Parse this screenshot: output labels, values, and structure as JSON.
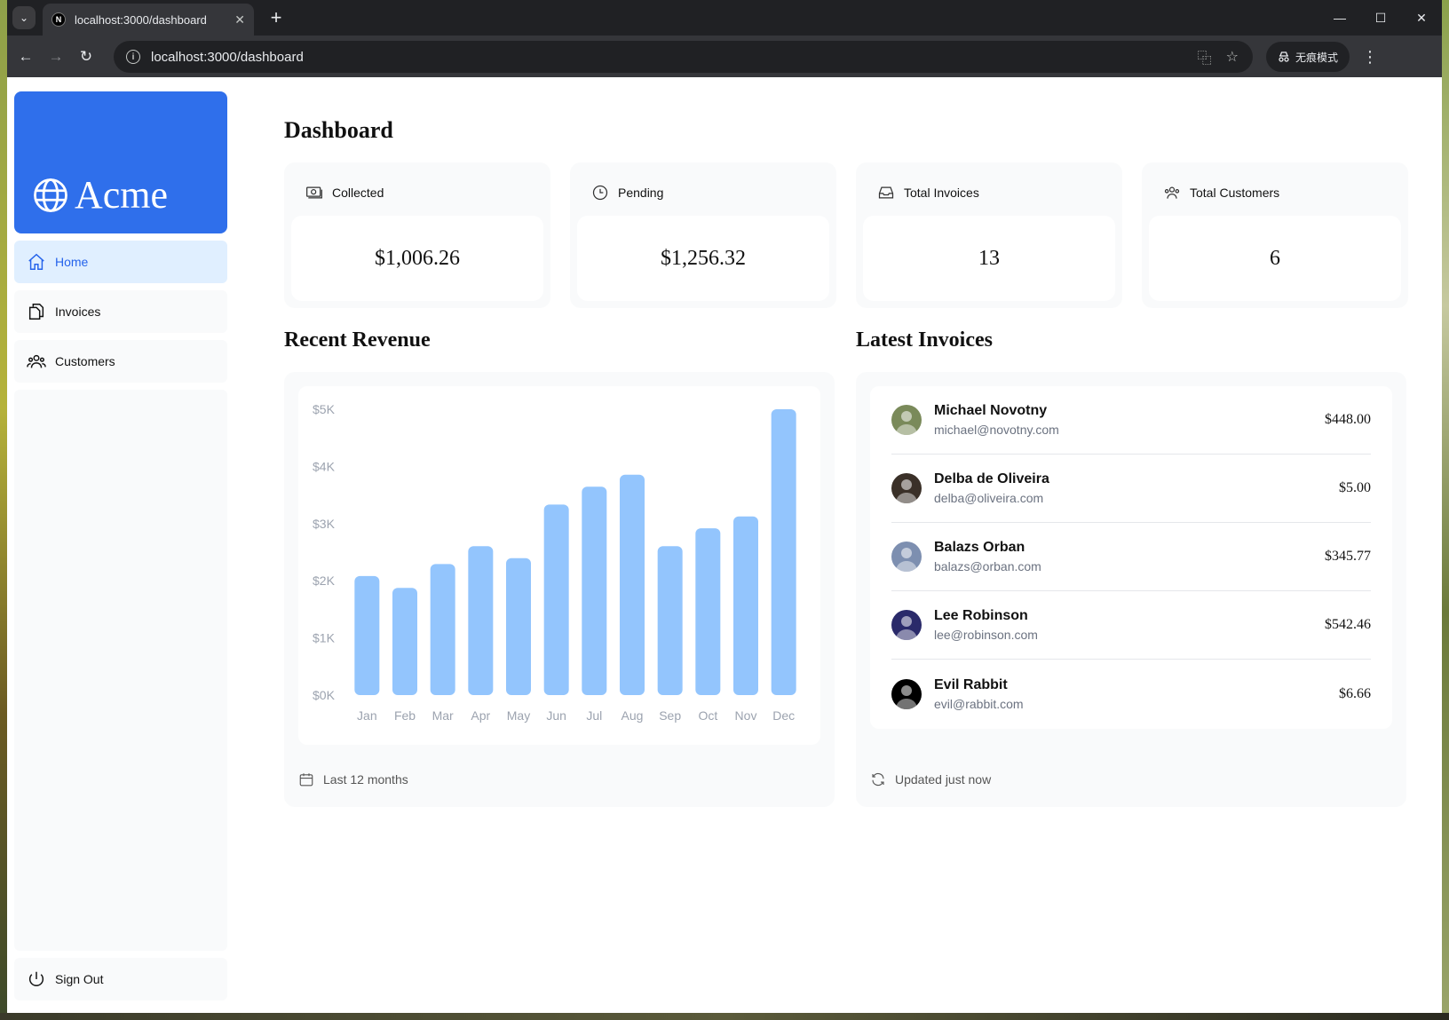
{
  "browser": {
    "tab_title": "localhost:3000/dashboard",
    "url": "localhost:3000/dashboard",
    "incognito_label": "无痕模式",
    "favicon_letter": "N"
  },
  "sidebar": {
    "logo_text": "Acme",
    "items": [
      {
        "label": "Home",
        "icon": "home-icon",
        "active": true
      },
      {
        "label": "Invoices",
        "icon": "document-icon",
        "active": false
      },
      {
        "label": "Customers",
        "icon": "users-icon",
        "active": false
      }
    ],
    "signout_label": "Sign Out"
  },
  "main": {
    "title": "Dashboard",
    "cards": [
      {
        "label": "Collected",
        "icon": "banknotes-icon",
        "value": "$1,006.26"
      },
      {
        "label": "Pending",
        "icon": "clock-icon",
        "value": "$1,256.32"
      },
      {
        "label": "Total Invoices",
        "icon": "inbox-icon",
        "value": "13"
      },
      {
        "label": "Total Customers",
        "icon": "user-group-icon",
        "value": "6"
      }
    ],
    "revenue_title": "Recent Revenue",
    "revenue_footer": "Last 12 months",
    "invoices_title": "Latest Invoices",
    "invoices_footer": "Updated just now",
    "latest_invoices": [
      {
        "name": "Michael Novotny",
        "email": "michael@novotny.com",
        "amount": "$448.00",
        "avatar_color": "#7a8a5a"
      },
      {
        "name": "Delba de Oliveira",
        "email": "delba@oliveira.com",
        "amount": "$5.00",
        "avatar_color": "#3a3028"
      },
      {
        "name": "Balazs Orban",
        "email": "balazs@orban.com",
        "amount": "$345.77",
        "avatar_color": "#7d8fb0"
      },
      {
        "name": "Lee Robinson",
        "email": "lee@robinson.com",
        "amount": "$542.46",
        "avatar_color": "#2a2a6a"
      },
      {
        "name": "Evil Rabbit",
        "email": "evil@rabbit.com",
        "amount": "$6.66",
        "avatar_color": "#000000"
      }
    ]
  },
  "colors": {
    "accent": "#2f6feb",
    "active_nav_bg": "#e0efff",
    "bar": "#93c5fd"
  },
  "chart_data": {
    "type": "bar",
    "categories": [
      "Jan",
      "Feb",
      "Mar",
      "Apr",
      "May",
      "Jun",
      "Jul",
      "Aug",
      "Sep",
      "Oct",
      "Nov",
      "Dec"
    ],
    "values": [
      2000,
      1800,
      2200,
      2500,
      2300,
      3200,
      3500,
      3700,
      2500,
      2800,
      3000,
      4800
    ],
    "y_ticks": [
      "$0K",
      "$1K",
      "$2K",
      "$3K",
      "$4K",
      "$5K"
    ],
    "ylim": [
      0,
      4800
    ],
    "grid": false
  }
}
